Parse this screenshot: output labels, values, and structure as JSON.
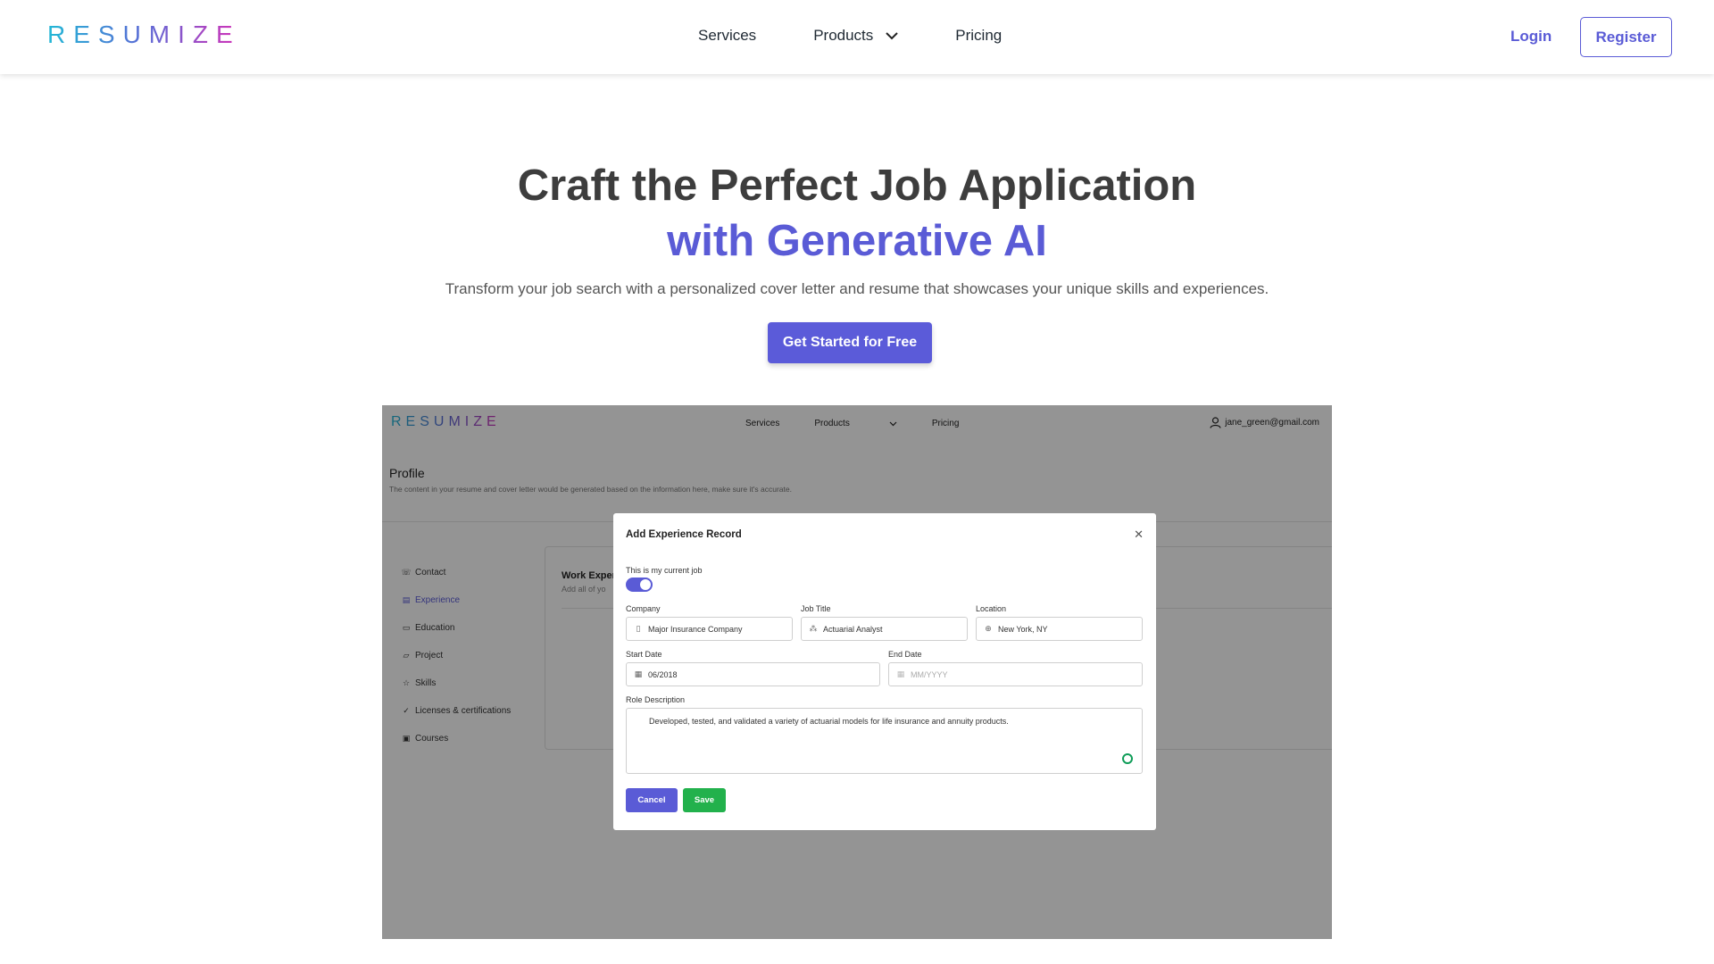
{
  "brand": {
    "logo_text": "RESUMIZE"
  },
  "nav": {
    "items": [
      "Services",
      "Products",
      "Pricing"
    ],
    "login": "Login",
    "register": "Register"
  },
  "hero": {
    "title": "Craft the Perfect Job Application",
    "title_accent": "with Generative AI",
    "description": "Transform your job search with a personalized cover letter and resume that showcases your unique skills and experiences.",
    "cta": "Get Started for Free"
  },
  "mock": {
    "logo_text": "RESUMIZE",
    "nav_items": [
      "Services",
      "Products",
      "Pricing"
    ],
    "user_email": "jane_green@gmail.com",
    "profile_title": "Profile",
    "profile_desc": "The content in your resume and cover letter would be generated based on the information here, make sure it's accurate.",
    "sidebar": [
      {
        "label": "Contact",
        "icon": "phone-icon"
      },
      {
        "label": "Experience",
        "icon": "briefcase-icon",
        "active": true
      },
      {
        "label": "Education",
        "icon": "id-card-icon"
      },
      {
        "label": "Project",
        "icon": "folder-icon"
      },
      {
        "label": "Skills",
        "icon": "star-icon"
      },
      {
        "label": "Licenses & certifications",
        "icon": "check-circle-icon"
      },
      {
        "label": "Courses",
        "icon": "book-icon"
      }
    ],
    "card_title": "Work Exper",
    "card_desc": "Add all of yo",
    "dialog": {
      "title": "Add Experience Record",
      "current_job_label": "This is my current job",
      "current_job_on": true,
      "company_label": "Company",
      "company_value": "Major Insurance Company",
      "job_title_label": "Job Title",
      "job_title_value": "Actuarial Analyst",
      "location_label": "Location",
      "location_value": "New York, NY",
      "start_label": "Start Date",
      "start_value": "06/2018",
      "end_label": "End Date",
      "end_placeholder": "MM/YYYY",
      "role_label": "Role Description",
      "role_value": "Developed, tested, and validated a variety of actuarial models for life insurance and annuity products.",
      "cancel": "Cancel",
      "save": "Save"
    }
  }
}
